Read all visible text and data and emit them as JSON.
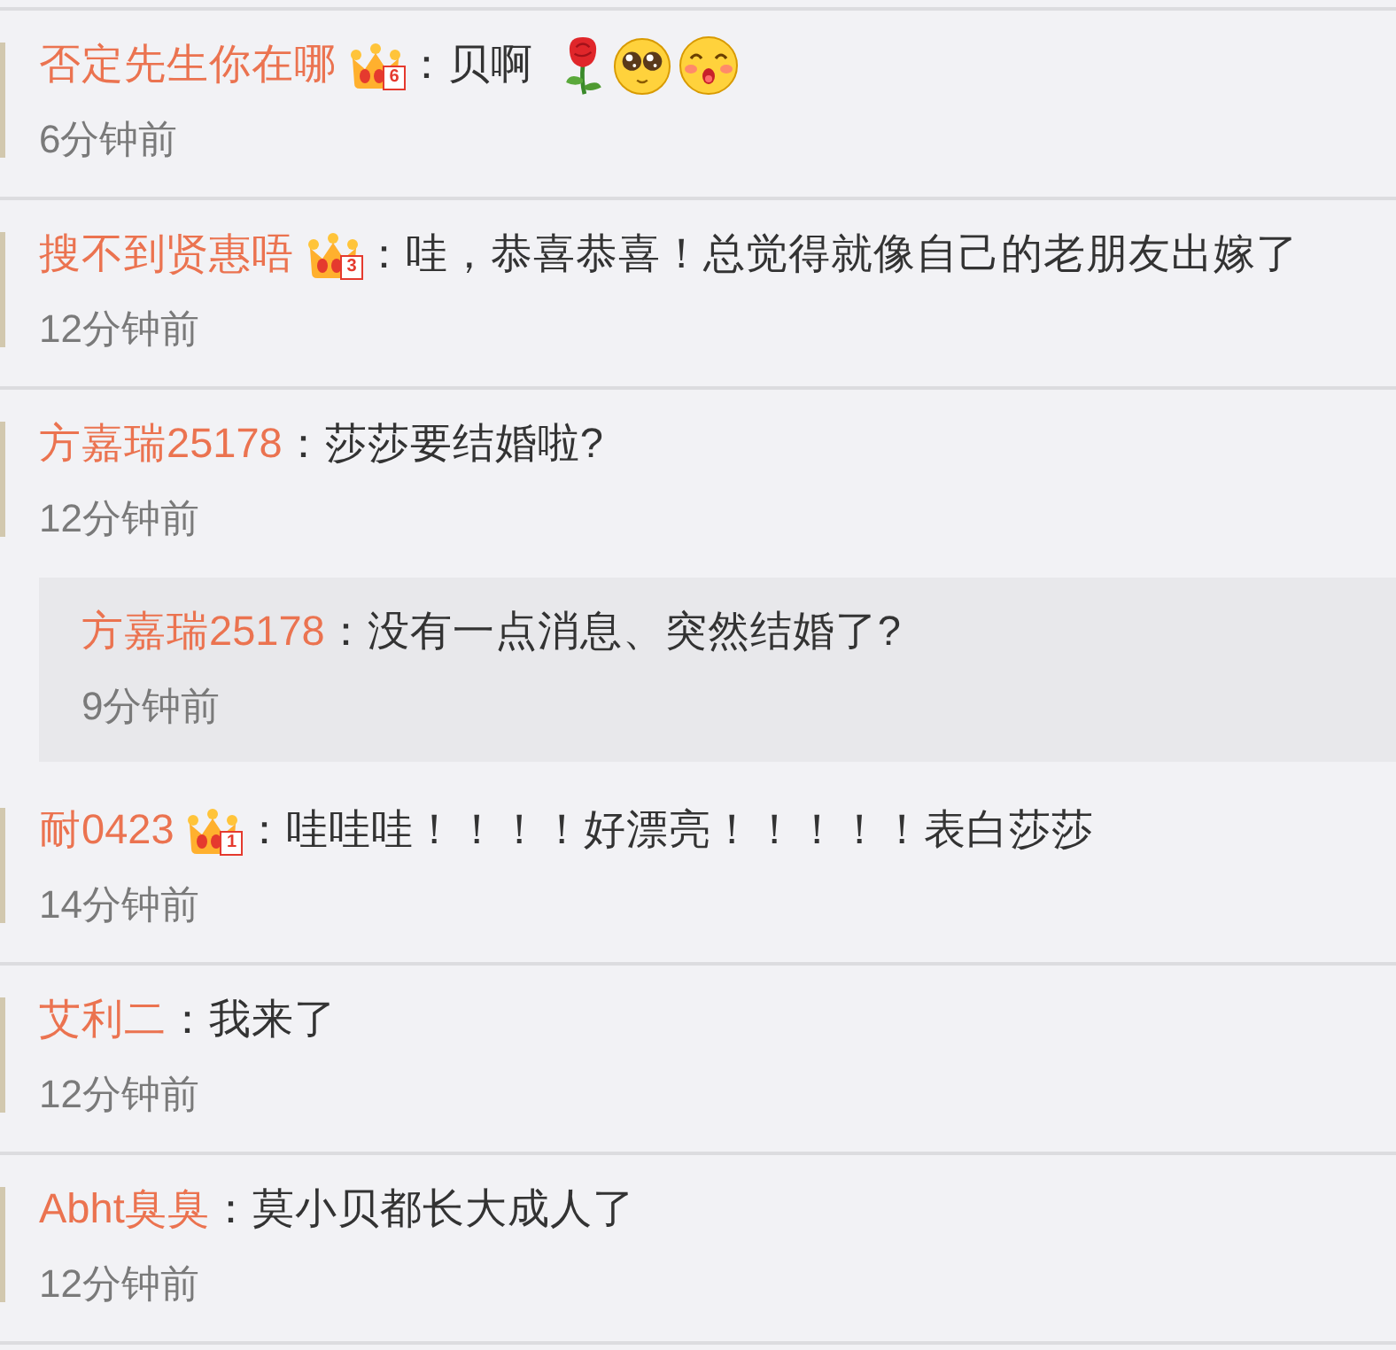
{
  "comments": [
    {
      "user": "否定先生你在哪",
      "badge": {
        "level_text": "6"
      },
      "text": "：贝啊",
      "emoticons": [
        {
          "kind": "rose"
        },
        {
          "kind": "big-eyes"
        },
        {
          "kind": "surprised"
        }
      ],
      "time": "6分钟前",
      "divider": true
    },
    {
      "user": "搜不到贤惠唔",
      "badge": {
        "level_text": "3"
      },
      "text": "：哇，恭喜恭喜！总觉得就像自己的老朋友出嫁了",
      "time": "12分钟前",
      "divider": true
    },
    {
      "user": "方嘉瑞25178",
      "text": "：莎莎要结婚啦?",
      "time": "12分钟前",
      "replies": [
        {
          "user": "方嘉瑞25178",
          "text": "：没有一点消息、突然结婚了?",
          "time": "9分钟前"
        }
      ],
      "divider": false
    },
    {
      "user": "耐0423",
      "badge": {
        "level_text": "1"
      },
      "text": "：哇哇哇！！！！好漂亮！！！！！表白莎莎",
      "time": "14分钟前",
      "divider": true
    },
    {
      "user": "艾利二",
      "text": "：我来了",
      "time": "12分钟前",
      "divider": true
    },
    {
      "user": "Abht臭臭",
      "text": "：莫小贝都长大成人了",
      "time": "12分钟前",
      "divider": true
    }
  ]
}
